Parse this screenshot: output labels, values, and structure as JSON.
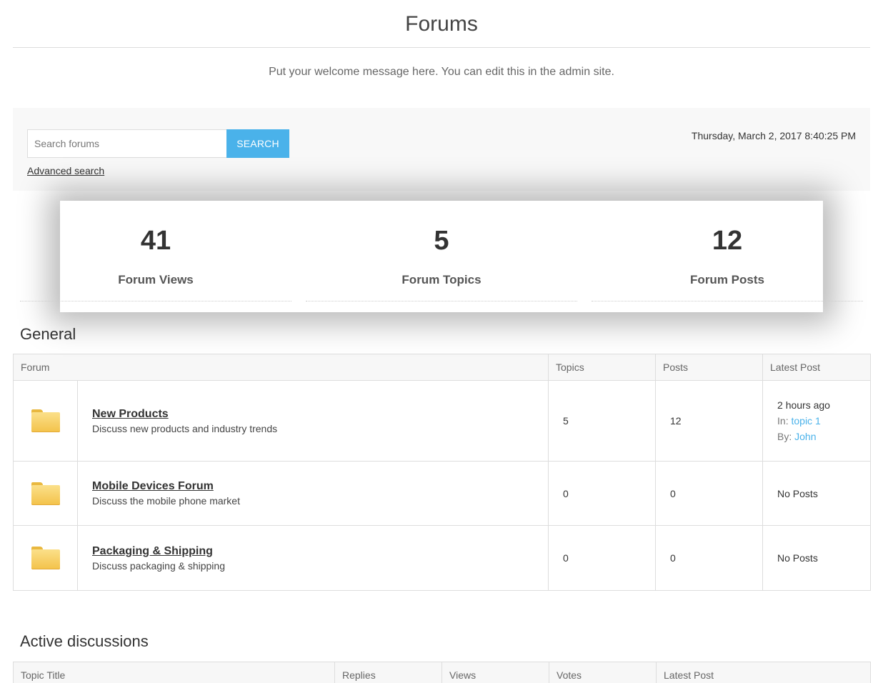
{
  "page": {
    "title": "Forums",
    "welcome": "Put your welcome message here. You can edit this in the admin site."
  },
  "search": {
    "placeholder": "Search forums",
    "value": "",
    "button_label": "SEARCH",
    "advanced_label": "Advanced search"
  },
  "datetime": "Thursday, March 2, 2017 8:40:25 PM",
  "stats": [
    {
      "value": "41",
      "label": "Forum Views"
    },
    {
      "value": "5",
      "label": "Forum Topics"
    },
    {
      "value": "12",
      "label": "Forum Posts"
    }
  ],
  "general": {
    "title": "General",
    "columns": [
      "Forum",
      "Topics",
      "Posts",
      "Latest Post"
    ],
    "rows": [
      {
        "icon": "folder-icon",
        "name": "New Products",
        "description": "Discuss new products and industry trends",
        "topics": "5",
        "posts": "12",
        "latest": {
          "time": "2 hours ago",
          "in_label": "In:",
          "topic": "topic 1",
          "by_label": "By:",
          "author": "John"
        }
      },
      {
        "icon": "folder-icon",
        "name": "Mobile Devices Forum",
        "description": "Discuss the mobile phone market",
        "topics": "0",
        "posts": "0",
        "latest_text": "No Posts"
      },
      {
        "icon": "folder-icon",
        "name": "Packaging & Shipping",
        "description": "Discuss packaging & shipping",
        "topics": "0",
        "posts": "0",
        "latest_text": "No Posts"
      }
    ]
  },
  "active": {
    "title": "Active discussions",
    "columns": [
      "Topic Title",
      "Replies",
      "Views",
      "Votes",
      "Latest Post"
    ]
  },
  "colors": {
    "accent": "#4ab2ea",
    "panel_bg": "#f8f8f8",
    "folder": "#f3c24a"
  }
}
